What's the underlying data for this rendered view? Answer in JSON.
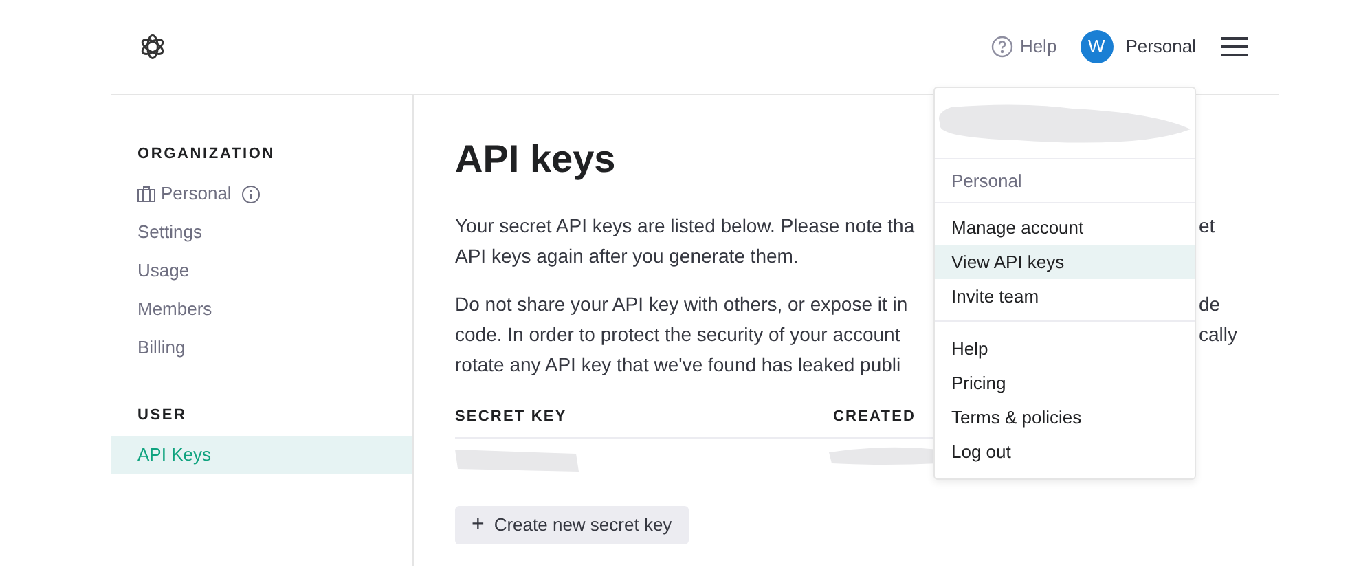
{
  "header": {
    "help_label": "Help",
    "account": {
      "avatar_initial": "W",
      "name": "Personal"
    }
  },
  "sidebar": {
    "sections": [
      {
        "heading": "ORGANIZATION",
        "items": [
          {
            "kind": "org",
            "label": "Personal",
            "selected": false
          },
          {
            "kind": "link",
            "label": "Settings",
            "selected": false
          },
          {
            "kind": "link",
            "label": "Usage",
            "selected": false
          },
          {
            "kind": "link",
            "label": "Members",
            "selected": false
          },
          {
            "kind": "link",
            "label": "Billing",
            "selected": false
          }
        ]
      },
      {
        "heading": "USER",
        "items": [
          {
            "kind": "link",
            "label": "API Keys",
            "selected": true
          }
        ]
      }
    ]
  },
  "main": {
    "title": "API keys",
    "paragraphs": [
      [
        {
          "left": "Your secret API keys are listed below. Please note tha",
          "right": "et"
        },
        {
          "left": "API keys again after you generate them."
        }
      ],
      [
        {
          "left": "Do not share your API key with others, or expose it in",
          "right": "de"
        },
        {
          "left": "code. In order to protect the security of your account",
          "right": "cally"
        },
        {
          "left": "rotate any API key that we've found has leaked publi"
        }
      ]
    ],
    "table": {
      "columns": [
        "SECRET KEY",
        "CREATED"
      ]
    },
    "create_button": {
      "icon": "+",
      "label": "Create new secret key"
    }
  },
  "menu": {
    "account_label": "Personal",
    "sections": [
      [
        {
          "label": "Manage account",
          "selected": false
        },
        {
          "label": "View API keys",
          "selected": true
        },
        {
          "label": "Invite team",
          "selected": false
        }
      ],
      [
        {
          "label": "Help",
          "selected": false
        },
        {
          "label": "Pricing",
          "selected": false
        },
        {
          "label": "Terms & policies",
          "selected": false
        },
        {
          "label": "Log out",
          "selected": false
        }
      ]
    ]
  }
}
